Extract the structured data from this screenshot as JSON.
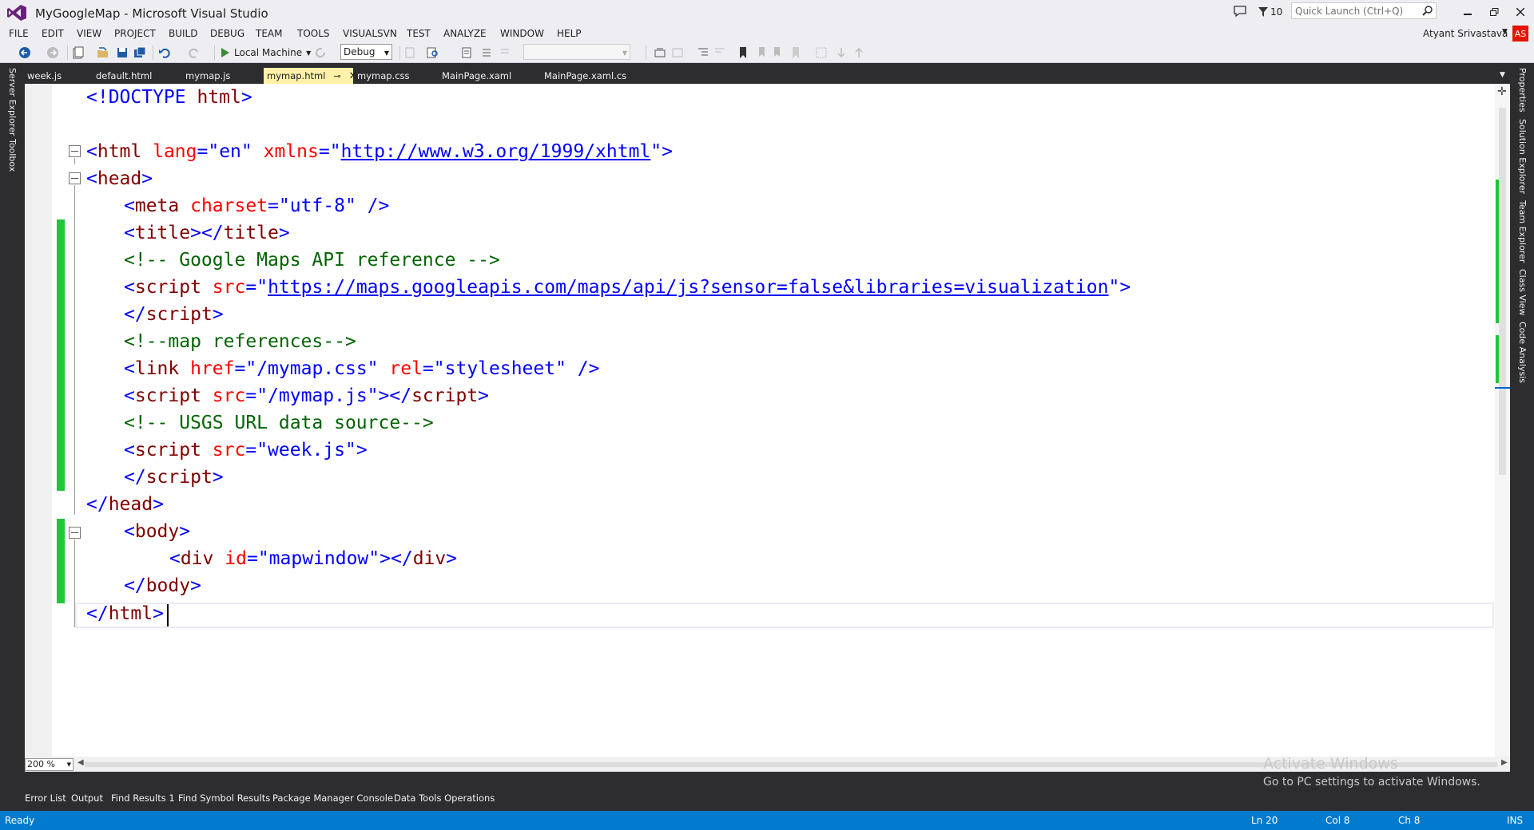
{
  "window": {
    "title": "MyGoogleMap - Microsoft Visual Studio",
    "notification_count": "10",
    "quick_launch_placeholder": "Quick Launch (Ctrl+Q)",
    "user_name": "Atyant Srivastava",
    "user_initials": "AS"
  },
  "menu": [
    "FILE",
    "EDIT",
    "VIEW",
    "PROJECT",
    "BUILD",
    "DEBUG",
    "TEAM",
    "TOOLS",
    "VISUALSVN",
    "TEST",
    "ANALYZE",
    "WINDOW",
    "HELP"
  ],
  "toolbar": {
    "run_target": "Local Machine",
    "configuration": "Debug"
  },
  "tabs": [
    {
      "label": "week.js"
    },
    {
      "label": "default.html"
    },
    {
      "label": "mymap.js"
    },
    {
      "label": "mymap.html",
      "active": true
    },
    {
      "label": "mymap.css"
    },
    {
      "label": "MainPage.xaml"
    },
    {
      "label": "MainPage.xaml.cs"
    }
  ],
  "left_rail": [
    "Server Explorer",
    "Toolbox"
  ],
  "right_rail": [
    "Properties",
    "Solution Explorer",
    "Team Explorer",
    "Class View",
    "Code Analysis"
  ],
  "code": {
    "l1": {
      "a": "<!DOCTYPE ",
      "b": "html",
      "c": ">"
    },
    "l3": {
      "a": "<",
      "b": "html",
      "c": " lang",
      "d": "=",
      "e": "\"en\"",
      "f": " xmlns",
      "g": "=",
      "h": "\"",
      "i": "http://www.w3.org/1999/xhtml",
      "j": "\"",
      "k": ">"
    },
    "l4": {
      "a": "<",
      "b": "head",
      "c": ">"
    },
    "l5": {
      "a": "<",
      "b": "meta",
      "c": " charset",
      "d": "=",
      "e": "\"utf-8\"",
      "f": " />"
    },
    "l6": {
      "a": "<",
      "b": "title",
      "c": "></",
      "d": "title",
      "e": ">"
    },
    "l7": {
      "a": "<!-- Google Maps API reference -->"
    },
    "l8": {
      "a": "<",
      "b": "script",
      "c": " src",
      "d": "=",
      "e": "\"",
      "f": "https://maps.googleapis.com/maps/api/js?sensor=false&libraries=visualization",
      "g": "\"",
      "h": ">"
    },
    "l9": {
      "a": "</",
      "b": "script",
      "c": ">"
    },
    "l10": {
      "a": "<!--map references-->"
    },
    "l11": {
      "a": "<",
      "b": "link",
      "c": " href",
      "d": "=",
      "e": "\"/mymap.css\"",
      "f": " rel",
      "g": "=",
      "h": "\"stylesheet\"",
      "i": " />"
    },
    "l12": {
      "a": "<",
      "b": "script",
      "c": " src",
      "d": "=",
      "e": "\"/mymap.js\"",
      "f": "></",
      "g": "script",
      "h": ">"
    },
    "l13": {
      "a": "<!-- USGS URL data source-->"
    },
    "l14": {
      "a": "<",
      "b": "script",
      "c": " src",
      "d": "=",
      "e": "\"week.js\"",
      "f": ">"
    },
    "l15": {
      "a": "</",
      "b": "script",
      "c": ">"
    },
    "l16": {
      "a": "</",
      "b": "head",
      "c": ">"
    },
    "l17": {
      "a": "<",
      "b": "body",
      "c": ">"
    },
    "l18": {
      "a": "<",
      "b": "div",
      "c": " id",
      "d": "=",
      "e": "\"mapwindow\"",
      "f": "></",
      "g": "div",
      "h": ">"
    },
    "l19": {
      "a": "</",
      "b": "body",
      "c": ">"
    },
    "l20": {
      "a": "</",
      "b": "html",
      "c": ">"
    }
  },
  "zoom": "200 %",
  "watermark": {
    "title": "Activate Windows",
    "subtitle": "Go to PC settings to activate Windows."
  },
  "bottom_tabs": [
    "Error List",
    "Output",
    "Find Results 1",
    "Find Symbol Results",
    "Package Manager Console",
    "Data Tools Operations"
  ],
  "status": {
    "state": "Ready",
    "line": "Ln 20",
    "col": "Col 8",
    "ch": "Ch 8",
    "mode": "INS"
  },
  "colors": {
    "accent": "#007acc",
    "active_tab": "#fff1a8",
    "change_marker": "#22c53a",
    "vs_purple": "#68217a"
  }
}
